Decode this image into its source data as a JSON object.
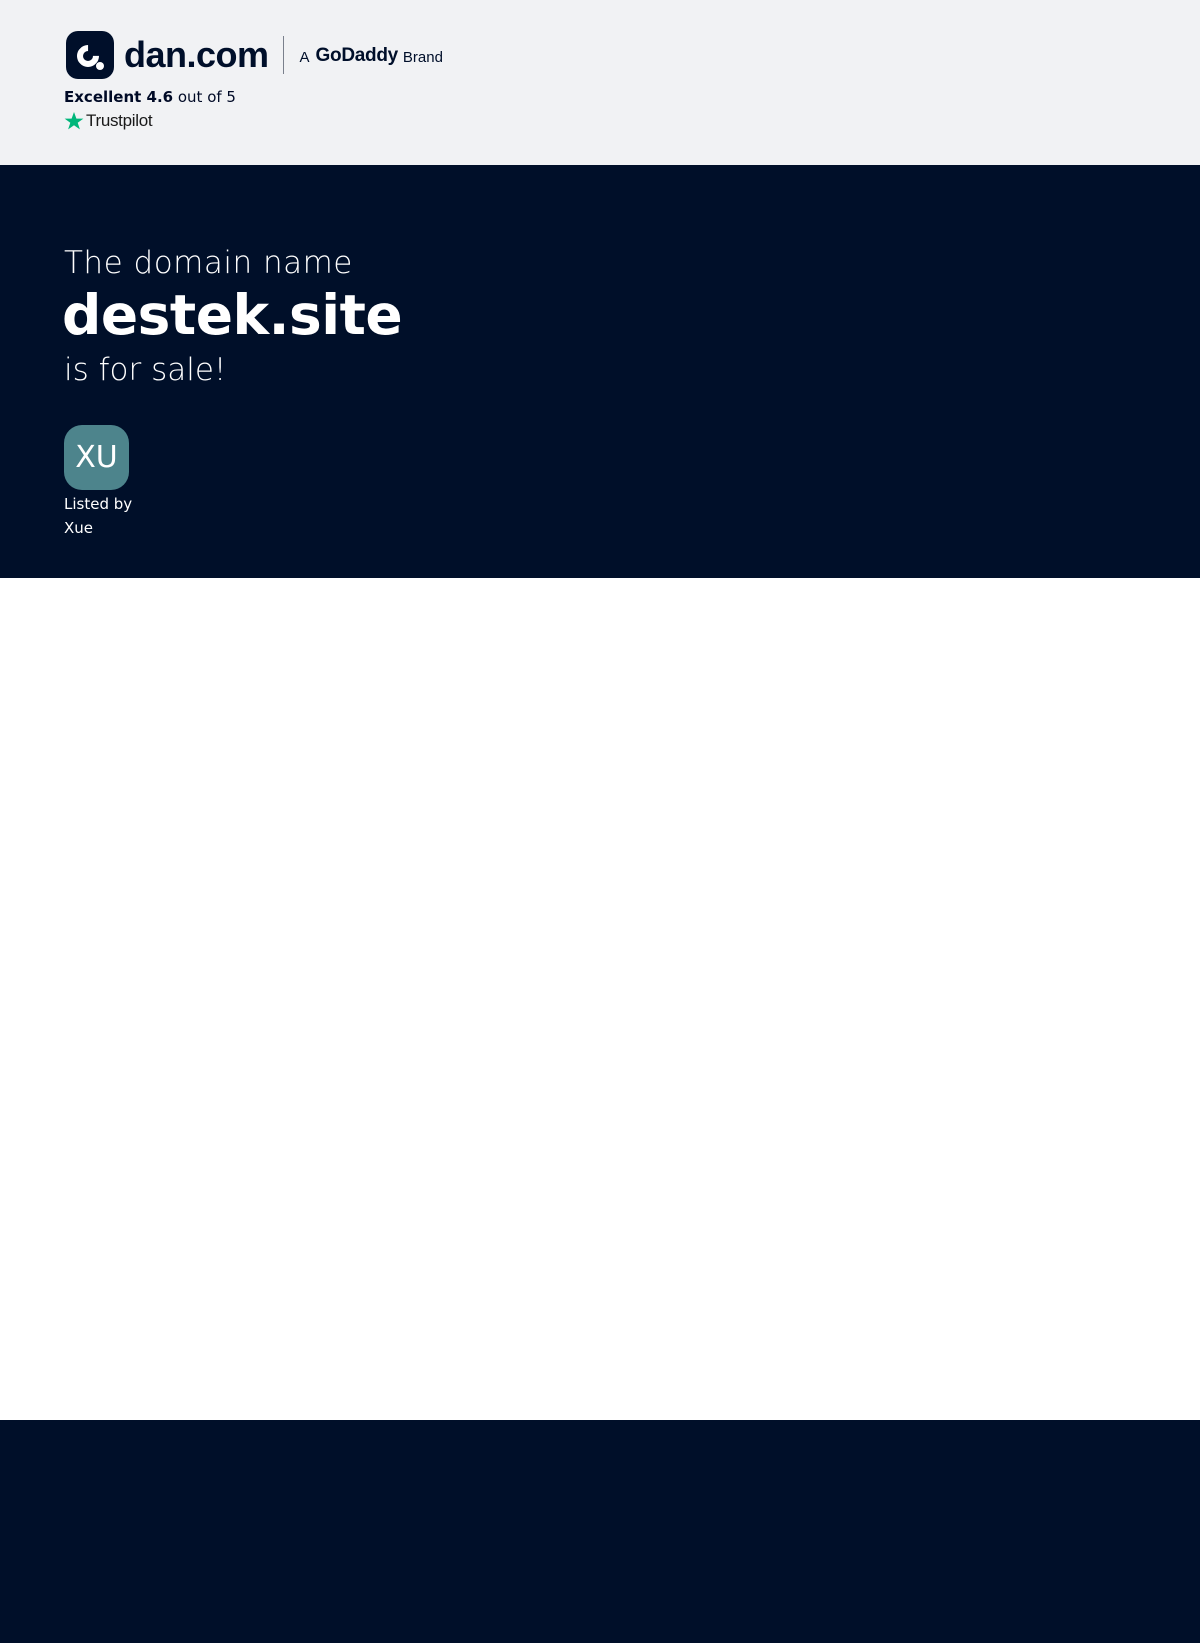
{
  "header": {
    "logo_text": "dan.com",
    "brand_prefix": "A",
    "brand_name": "GoDaddy",
    "brand_suffix": "Brand",
    "rating_label": "Excellent 4.6",
    "rating_suffix": "out of 5",
    "trustpilot_label": "Trustpilot",
    "trustpilot_color": "#00b67a"
  },
  "hero": {
    "intro": "The domain name",
    "domain": "destek.site",
    "outro": "is for sale!",
    "seller_initials": "XU",
    "listed_by": "Listed by",
    "seller_name": "Xue",
    "avatar_color": "#4d848c"
  },
  "colors": {
    "navy": "#000f29",
    "topbar": "#f1f2f4"
  }
}
